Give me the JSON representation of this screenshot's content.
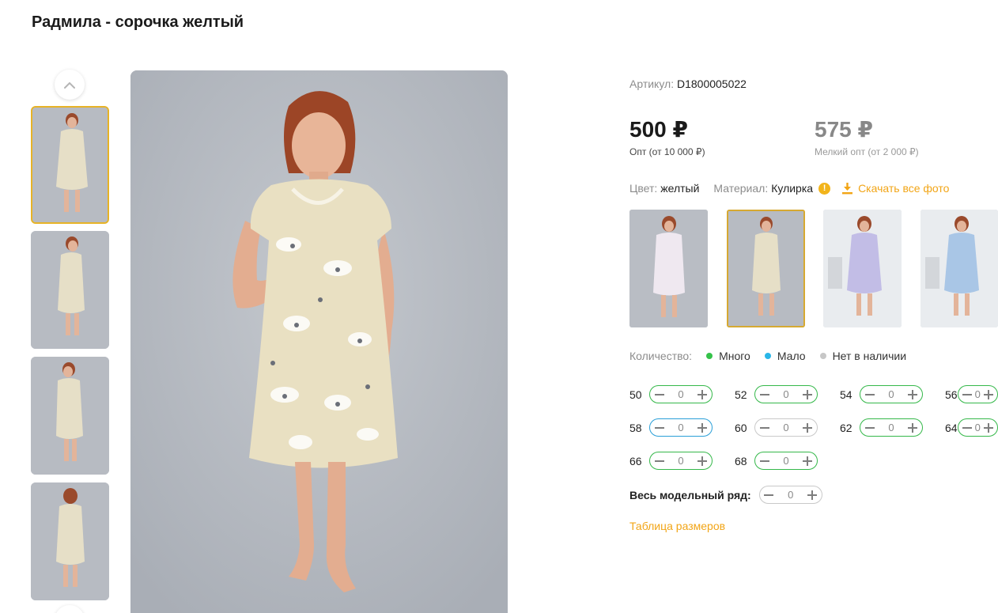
{
  "product": {
    "title": "Радмила - сорочка желтый",
    "sku_label": "Артикул:",
    "sku_value": "D1800005022"
  },
  "prices": {
    "wholesale": {
      "value": "500 ₽",
      "note": "Опт (от 10 000 ₽)"
    },
    "small_wholesale": {
      "value": "575 ₽",
      "note": "Мелкий опт (от 2 000 ₽)"
    }
  },
  "props": {
    "color_label": "Цвет:",
    "color_value": "желтый",
    "material_label": "Материал:",
    "material_value": "Кулирка",
    "info_icon_glyph": "!",
    "download_label": "Скачать все фото"
  },
  "legend": {
    "label": "Количество:",
    "items": [
      {
        "label": "Много",
        "color": "#35c24a"
      },
      {
        "label": "Мало",
        "color": "#2ab6e8"
      },
      {
        "label": "Нет в наличии",
        "color": "#c7c7c7"
      }
    ]
  },
  "sizes": [
    {
      "size": "50",
      "qty": "0"
    },
    {
      "size": "52",
      "qty": "0"
    },
    {
      "size": "54",
      "qty": "0"
    },
    {
      "size": "56",
      "qty": "0"
    },
    {
      "size": "58",
      "qty": "0"
    },
    {
      "size": "60",
      "qty": "0"
    },
    {
      "size": "62",
      "qty": "0"
    },
    {
      "size": "64",
      "qty": "0"
    },
    {
      "size": "66",
      "qty": "0"
    },
    {
      "size": "68",
      "qty": "0"
    }
  ],
  "whole_range": {
    "label": "Весь модельный ряд:",
    "qty": "0"
  },
  "size_table_link": "Таблица размеров",
  "colors": {
    "accent": "#f2a516",
    "stock_many": "#35b84a",
    "stock_few": "#2a9fd8",
    "stock_none": "#c9c9c9"
  }
}
